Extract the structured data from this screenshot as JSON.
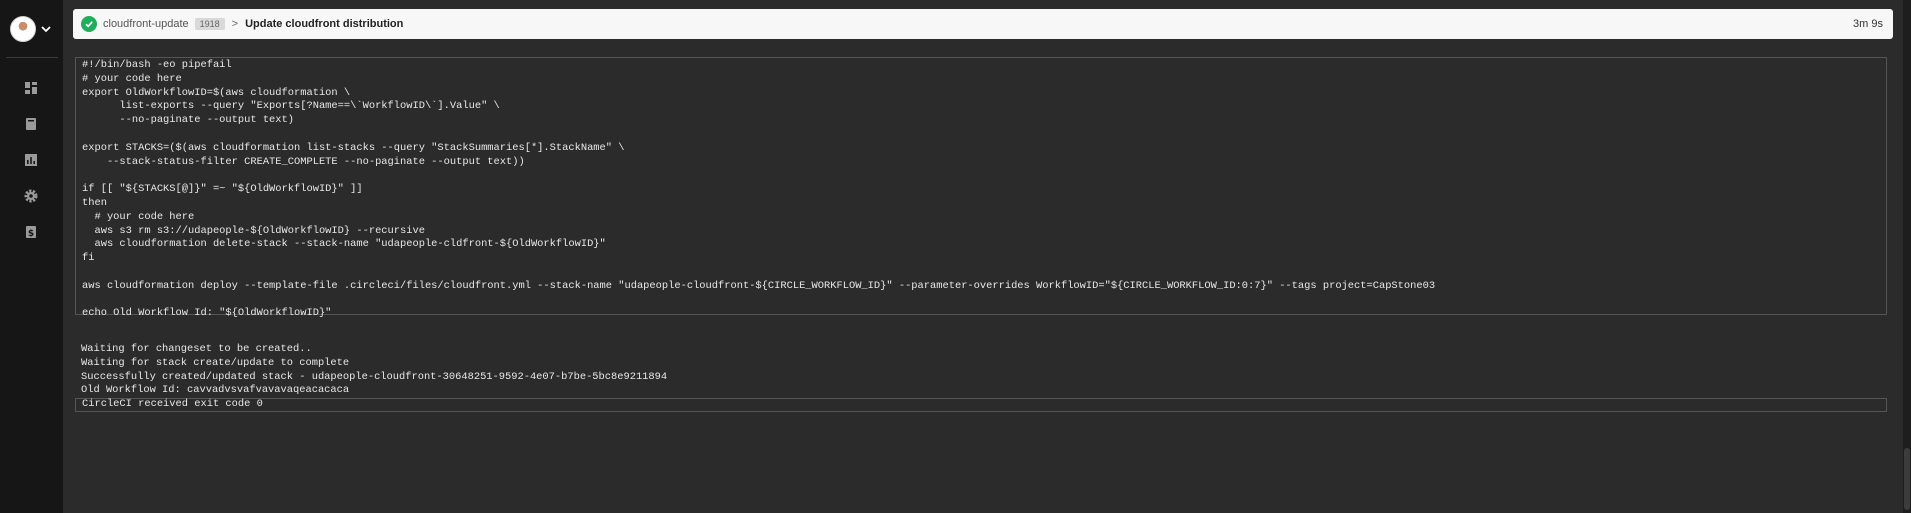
{
  "sidebar": {
    "items": [
      {
        "icon": "dashboard-icon"
      },
      {
        "icon": "projects-icon"
      },
      {
        "icon": "insights-icon"
      },
      {
        "icon": "settings-icon"
      },
      {
        "icon": "plan-icon"
      }
    ]
  },
  "header": {
    "status_icon": "success-check-icon",
    "job_name": "cloudfront-update",
    "job_number": "1918",
    "separator": ">",
    "step_title": "Update cloudfront distribution",
    "duration": "3m 9s"
  },
  "step": {
    "command": "#!/bin/bash -eo pipefail\n# your code here\nexport OldWorkflowID=$(aws cloudformation \\\n      list-exports --query \"Exports[?Name==\\`WorkflowID\\`].Value\" \\\n      --no-paginate --output text)\n\nexport STACKS=($(aws cloudformation list-stacks --query \"StackSummaries[*].StackName\" \\\n    --stack-status-filter CREATE_COMPLETE --no-paginate --output text))\n\nif [[ \"${STACKS[@]}\" =~ \"${OldWorkflowID}\" ]]\nthen\n  # your code here\n  aws s3 rm s3://udapeople-${OldWorkflowID} --recursive\n  aws cloudformation delete-stack --stack-name \"udapeople-cldfront-${OldWorkflowID}\"\nfi\n\naws cloudformation deploy --template-file .circleci/files/cloudfront.yml --stack-name \"udapeople-cloudfront-${CIRCLE_WORKFLOW_ID}\" --parameter-overrides WorkflowID=\"${CIRCLE_WORKFLOW_ID:0:7}\" --tags project=CapStone03\n\necho Old Workflow Id: \"${OldWorkflowID}\"",
    "output": "Waiting for changeset to be created..\nWaiting for stack create/update to complete\nSuccessfully created/updated stack - udapeople-cloudfront-30648251-9592-4e07-b7be-5bc8e9211894\nOld Workflow Id: cavvadvsvafvavavaqeacacaca",
    "exit_message": "CircleCI received exit code 0"
  }
}
